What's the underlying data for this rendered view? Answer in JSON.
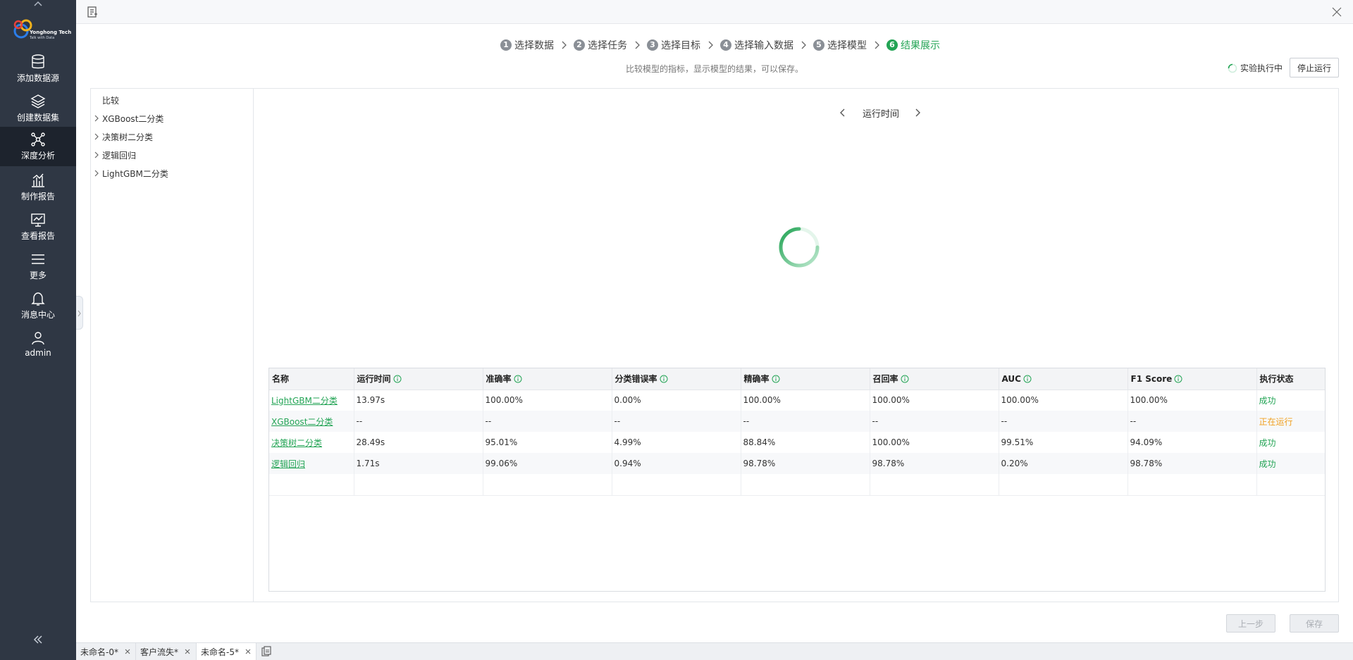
{
  "sidebar": {
    "logo": {
      "brand": "Yonghong Tech",
      "slogan": "Talk with Data"
    },
    "items": [
      {
        "label": "添加数据源",
        "icon": "database-icon"
      },
      {
        "label": "创建数据集",
        "icon": "layers-icon"
      },
      {
        "label": "深度分析",
        "icon": "network-icon",
        "active": true
      },
      {
        "label": "制作报告",
        "icon": "bar-chart-icon"
      },
      {
        "label": "查看报告",
        "icon": "line-chart-icon"
      },
      {
        "label": "更多",
        "icon": "menu-icon"
      },
      {
        "label": "消息中心",
        "icon": "bell-icon"
      },
      {
        "label": "admin",
        "icon": "user-icon"
      }
    ]
  },
  "steps": [
    {
      "num": "1",
      "label": "选择数据"
    },
    {
      "num": "2",
      "label": "选择任务"
    },
    {
      "num": "3",
      "label": "选择目标"
    },
    {
      "num": "4",
      "label": "选择输入数据"
    },
    {
      "num": "5",
      "label": "选择模型"
    },
    {
      "num": "6",
      "label": "结果展示",
      "active": true
    }
  ],
  "subtitle": "比较模型的指标，显示模型的结果，可以保存。",
  "status": {
    "running_label": "实验执行中",
    "stop_label": "停止运行"
  },
  "tree": {
    "root": "比较",
    "nodes": [
      "XGBoost二分类",
      "决策树二分类",
      "逻辑回归",
      "LightGBM二分类"
    ]
  },
  "metric_nav": {
    "title": "运行时间"
  },
  "table": {
    "headers": [
      "名称",
      "运行时间",
      "准确率",
      "分类错误率",
      "精确率",
      "召回率",
      "AUC",
      "F1 Score",
      "执行状态"
    ],
    "rows": [
      [
        "LightGBM二分类",
        "13.97s",
        "100.00%",
        "0.00%",
        "100.00%",
        "100.00%",
        "100.00%",
        "100.00%",
        "成功"
      ],
      [
        "XGBoost二分类",
        "--",
        "--",
        "--",
        "--",
        "--",
        "--",
        "--",
        "正在运行"
      ],
      [
        "决策树二分类",
        "28.49s",
        "95.01%",
        "4.99%",
        "88.84%",
        "100.00%",
        "99.51%",
        "94.09%",
        "成功"
      ],
      [
        "逻辑回归",
        "1.71s",
        "99.06%",
        "0.94%",
        "98.78%",
        "98.78%",
        "0.20%",
        "98.78%",
        "成功"
      ]
    ]
  },
  "buttons": {
    "prev": "上一步",
    "save": "保存"
  },
  "tabs": [
    {
      "label": "未命名-0*"
    },
    {
      "label": "客户流失*"
    },
    {
      "label": "未命名-5*",
      "active": true
    }
  ],
  "colors": {
    "accent": "#23a455",
    "running": "#f0a020",
    "sidebar": "#2f3744"
  }
}
